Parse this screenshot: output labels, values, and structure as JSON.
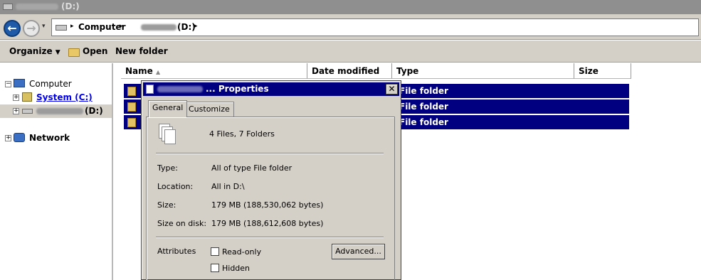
{
  "window": {
    "title_drive": "(D:)"
  },
  "address": {
    "computer_crumb": "Computer",
    "drive_crumb": "(D:)",
    "sep": "▸",
    "dropdown": "▾"
  },
  "toolbar": {
    "organize": "Organize",
    "open": "Open",
    "new_folder": "New folder"
  },
  "nav": {
    "computer": "Computer",
    "system_c": "System (C:)",
    "drive_d": "(D:)",
    "network": "Network"
  },
  "columns": [
    "Name",
    "Date modified",
    "Type",
    "Size"
  ],
  "rows": [
    {
      "type": "File folder"
    },
    {
      "type": "File folder"
    },
    {
      "type": "File folder"
    }
  ],
  "dialog": {
    "title": "... Properties",
    "close": "✕",
    "tabs": [
      "General",
      "Customize"
    ],
    "summary": "4 Files, 7 Folders",
    "properties": [
      {
        "label": "Type:",
        "value": "All of type File folder"
      },
      {
        "label": "Location:",
        "value": "All in D:\\"
      },
      {
        "label": "Size:",
        "value": "179 MB (188,530,062 bytes)"
      },
      {
        "label": "Size on disk:",
        "value": "179 MB (188,612,608 bytes)"
      }
    ],
    "attributes_label": "Attributes",
    "readonly_label": "Read-only",
    "hidden_label": "Hidden",
    "advanced_label": "Advanced..."
  }
}
